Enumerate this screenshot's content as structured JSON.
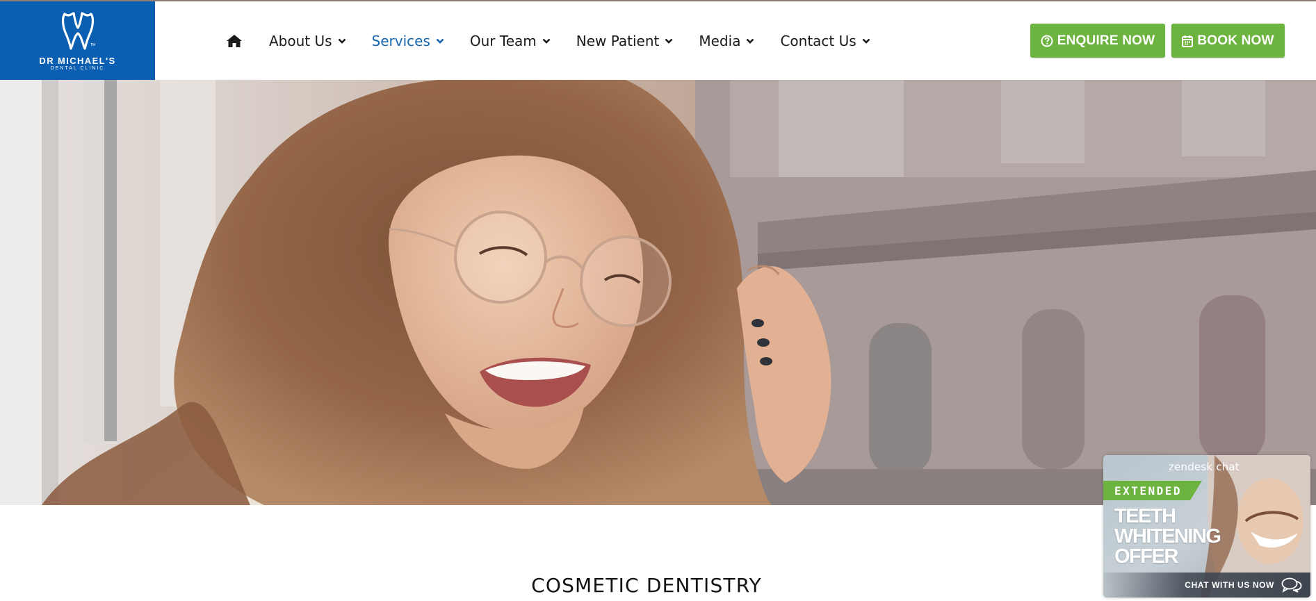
{
  "logo": {
    "name": "DR MICHAEL'S",
    "subtitle": "DENTAL CLINIC",
    "icon": "tooth-icon",
    "background": "#0b5fb3"
  },
  "nav": {
    "home_icon": "home-icon",
    "items": [
      {
        "label": "About Us",
        "active": false
      },
      {
        "label": "Services",
        "active": true
      },
      {
        "label": "Our Team",
        "active": false
      },
      {
        "label": "New Patient",
        "active": false
      },
      {
        "label": "Media",
        "active": false
      },
      {
        "label": "Contact Us",
        "active": false
      }
    ],
    "active_color": "#1565ad"
  },
  "buttons": {
    "enquire": {
      "label": "ENQUIRE NOW",
      "icon": "question-circle-icon"
    },
    "book": {
      "label": "BOOK NOW",
      "icon": "calendar-icon"
    },
    "color": "#6cb33f"
  },
  "hero": {
    "alt": "smiling woman with glasses"
  },
  "section": {
    "title": "COSMETIC DENTISTRY"
  },
  "chat_widget": {
    "brand": "zendesk chat",
    "badge": "EXTENDED",
    "offer_lines": [
      "TEETH",
      "WHITENING",
      "OFFER"
    ],
    "cta": "CHAT WITH US NOW",
    "cta_icon": "chat-bubbles-icon"
  }
}
